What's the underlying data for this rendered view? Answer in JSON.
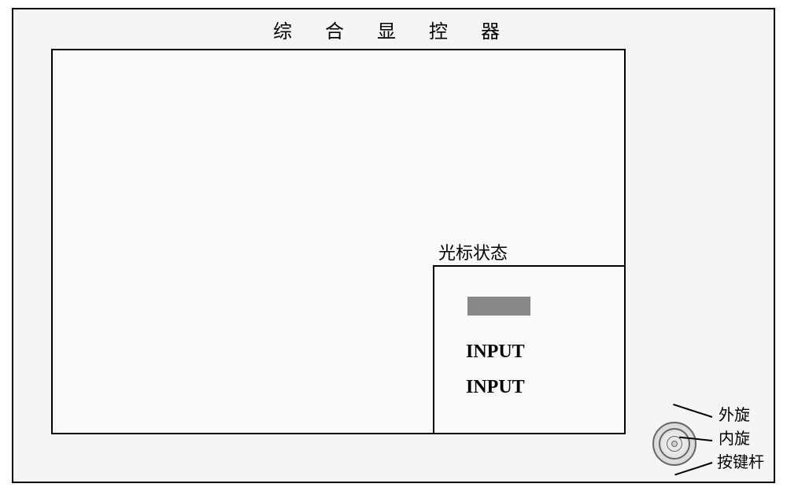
{
  "title": "综 合 显 控 器",
  "cursor_label": "光标状态",
  "inputs": {
    "line1": "INPUT",
    "line2": "INPUT"
  },
  "knob_labels": {
    "outer": "外旋",
    "inner": "内旋",
    "button": "按键杆"
  }
}
